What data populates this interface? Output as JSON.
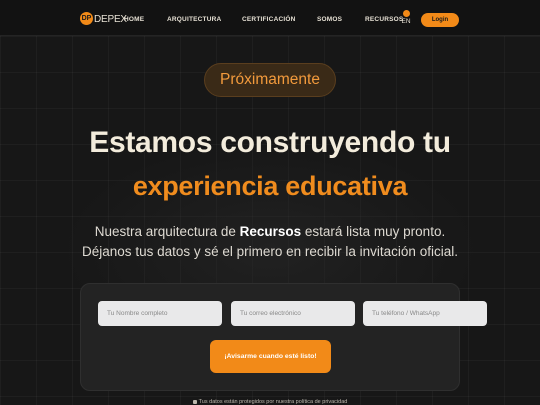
{
  "brand": {
    "logo_mark": "DP",
    "name": "DEPEX",
    "accent_color": "#f28a18"
  },
  "nav": {
    "items": [
      {
        "label": "HOME"
      },
      {
        "label": "ARQUITECTURA"
      },
      {
        "label": "CERTIFICACIÓN"
      },
      {
        "label": "SOMOS"
      },
      {
        "label": "RECURSOS"
      }
    ],
    "language": "EN",
    "login_label": "Login"
  },
  "hero": {
    "badge": "Próximamente",
    "headline": "Estamos construyendo tu",
    "headline_accent": "experiencia educativa",
    "sub_line1_prefix": "Nuestra arquitectura de ",
    "sub_line1_bold": "Recursos",
    "sub_line1_suffix": " estará lista muy pronto.",
    "sub_line2": "Déjanos tus datos y sé el primero en recibir la invitación oficial."
  },
  "form": {
    "name_placeholder": "Tu Nombre completo",
    "email_placeholder": "Tu correo electrónico",
    "phone_placeholder": "Tu teléfono / WhatsApp",
    "submit_label": "¡Avisarme cuando esté listo!",
    "privacy_note": "Tus datos están protegidos por nuestra política de privacidad"
  }
}
